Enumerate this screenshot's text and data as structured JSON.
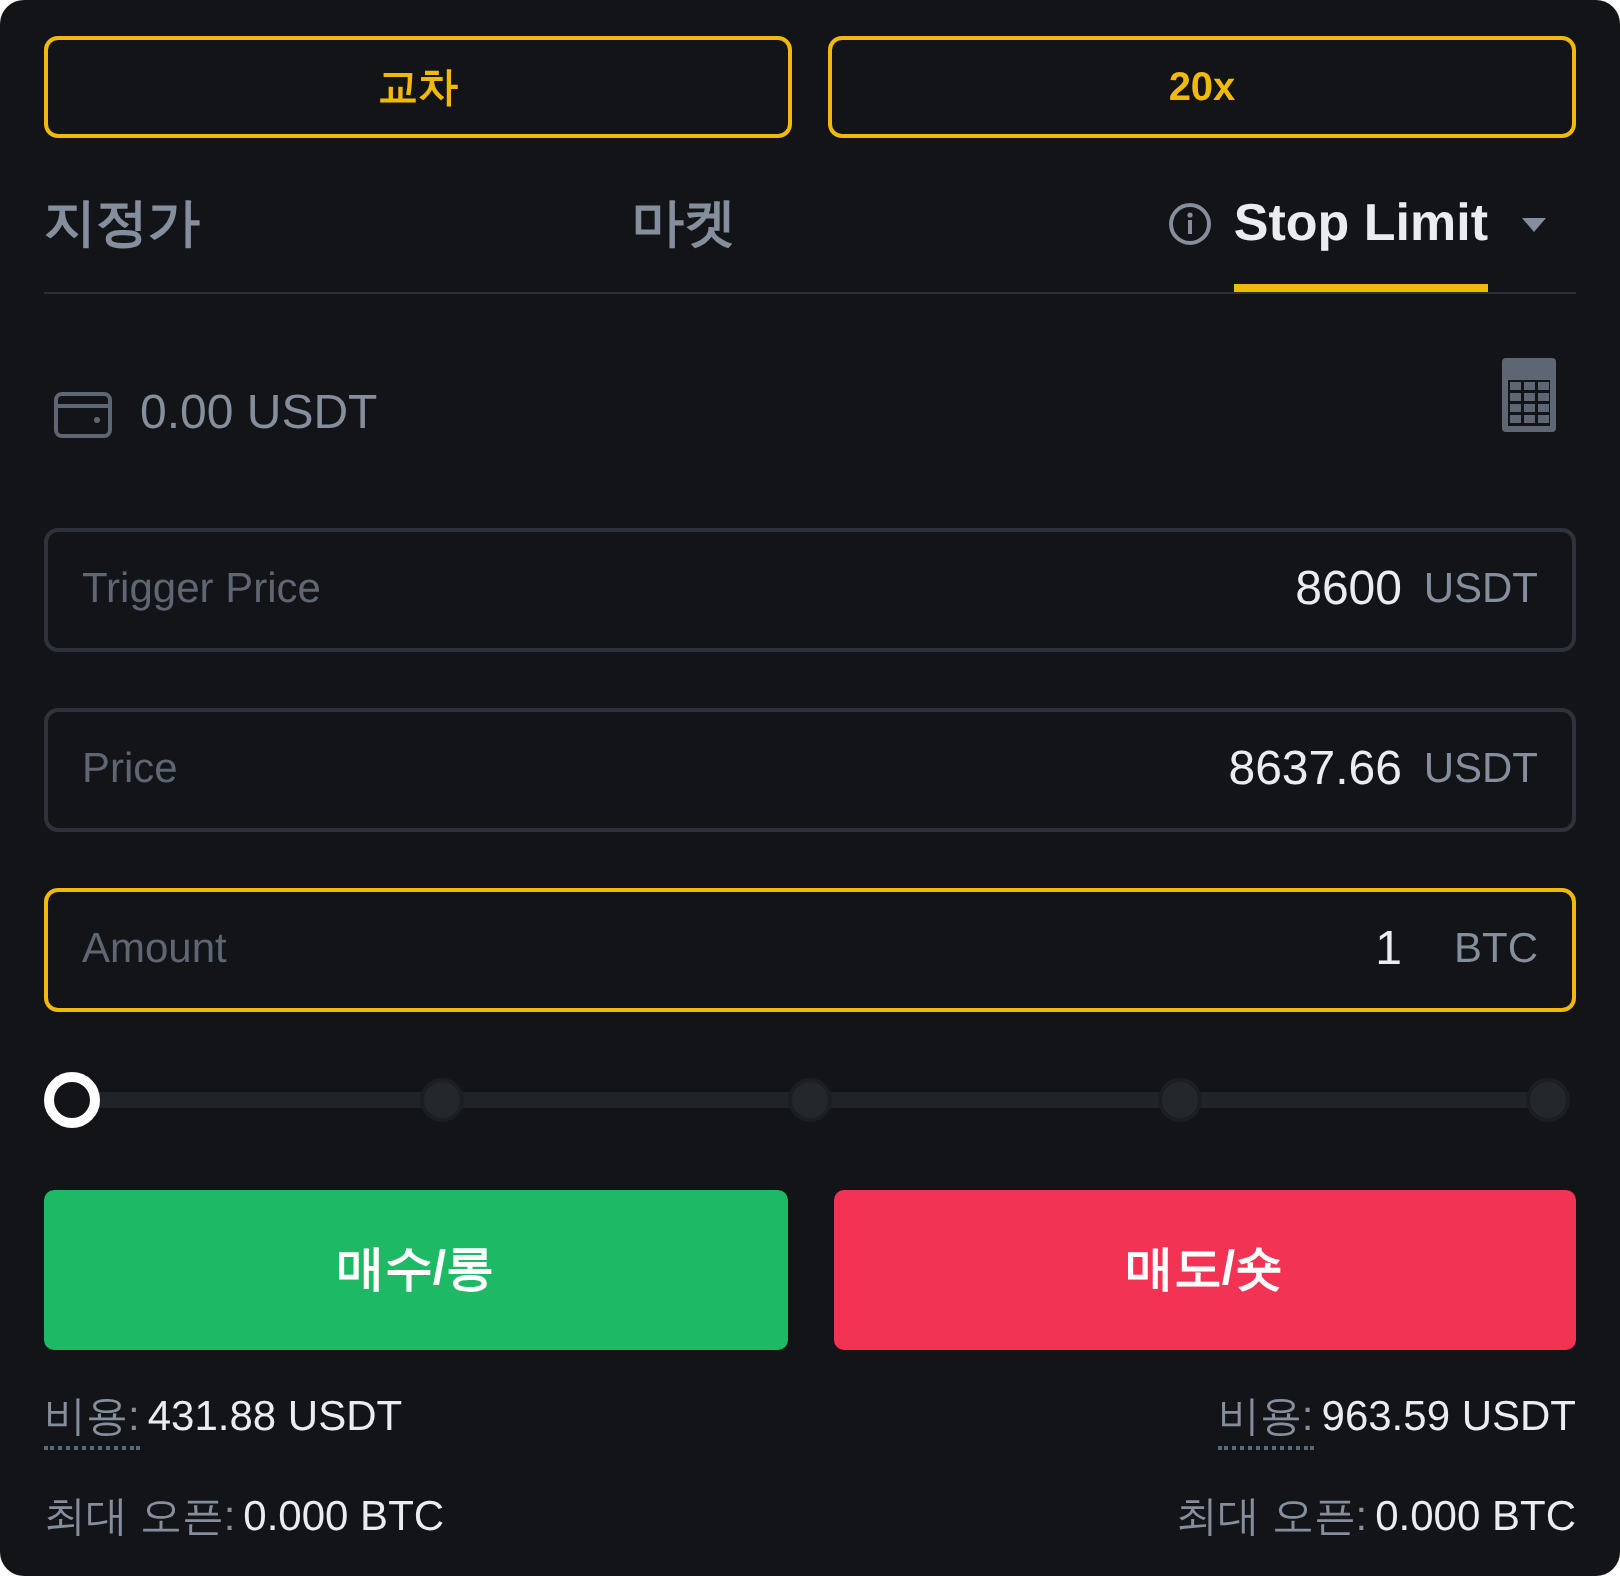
{
  "margin_mode_button": {
    "label": "교차"
  },
  "leverage_button": {
    "label": "20x"
  },
  "order_type_tabs": [
    {
      "label": "지정가",
      "selected": false,
      "kind": "plain"
    },
    {
      "label": "마켓",
      "selected": false,
      "kind": "plain"
    },
    {
      "label": "Stop Limit",
      "selected": true,
      "kind": "dropdown"
    }
  ],
  "balance": {
    "text": "0.00 USDT"
  },
  "inputs": [
    {
      "label": "Trigger Price",
      "value": "8600",
      "unit": "USDT",
      "focused": false
    },
    {
      "label": "Price",
      "value": "8637.66",
      "unit": "USDT",
      "focused": false
    },
    {
      "label": "Amount",
      "value": "1",
      "unit": "BTC",
      "focused": true
    }
  ],
  "amount_slider": {
    "level": 0
  },
  "action_buttons": [
    {
      "label": "매수/롱",
      "kind": "buy"
    },
    {
      "label": "매도/숏",
      "kind": "sell"
    }
  ],
  "order_summaries": [
    {
      "cost_label": "비용:",
      "cost": "431.88 USDT",
      "max_open_label": "최대 오픈:",
      "max_open": "0.000 BTC"
    },
    {
      "cost_label": "비용:",
      "cost": "963.59 USDT",
      "max_open_label": "최대 오픈:",
      "max_open": "0.000 BTC"
    }
  ]
}
